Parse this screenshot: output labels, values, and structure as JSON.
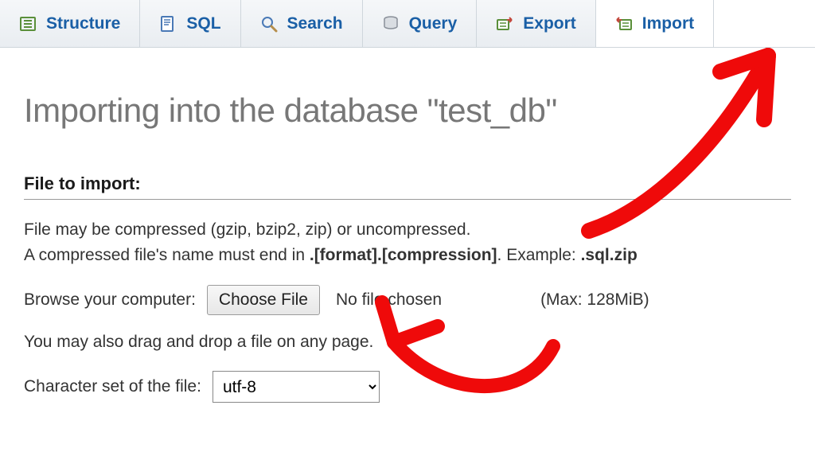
{
  "tabs": [
    {
      "label": "Structure"
    },
    {
      "label": "SQL"
    },
    {
      "label": "Search"
    },
    {
      "label": "Query"
    },
    {
      "label": "Export"
    },
    {
      "label": "Import"
    }
  ],
  "page_title": "Importing into the database \"test_db\"",
  "section_heading": "File to import:",
  "compress_line": "File may be compressed (gzip, bzip2, zip) or uncompressed.",
  "name_rule_pre": "A compressed file's name must end in ",
  "name_rule_bold1": ".[format].[compression]",
  "name_rule_mid": ". Example: ",
  "name_rule_bold2": ".sql.zip",
  "browse_label": "Browse your computer:",
  "choose_file_btn": "Choose File",
  "file_status": "No file chosen",
  "max_size": "(Max: 128MiB)",
  "dragdrop_line": "You may also drag and drop a file on any page.",
  "charset_label": "Character set of the file:",
  "charset_value": "utf-8"
}
